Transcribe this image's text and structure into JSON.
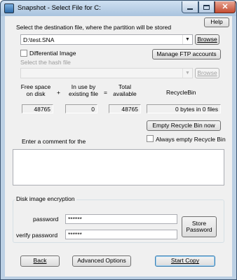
{
  "window": {
    "title": "Snapshot - Select File for C:",
    "help_label": "Help"
  },
  "destination": {
    "label": "Select the destination file, where the partition will be stored",
    "value": "D:\\test.SNA",
    "browse_label": "Browse"
  },
  "differential": {
    "checkbox_label": "Differential Image",
    "checked": false,
    "manage_ftp_label": "Manage FTP accounts",
    "hash_label": "Select the hash file",
    "hash_value": "",
    "hash_browse_label": "Browse"
  },
  "disk_stats": {
    "free_label_1": "Free space",
    "free_label_2": "on disk",
    "plus": "+",
    "inuse_label_1": "In use by",
    "inuse_label_2": "existing file",
    "equals": "=",
    "total_label_1": "Total",
    "total_label_2": "available",
    "recycle_label": "RecycleBin",
    "free_value": "48765",
    "inuse_value": "0",
    "total_value": "48765",
    "recycle_value": "0 bytes in 0 files"
  },
  "recycle": {
    "empty_button": "Empty Recycle Bin now",
    "always_label": "Always empty Recycle Bin",
    "always_checked": false
  },
  "comment": {
    "label": "Enter a comment for the",
    "value": ""
  },
  "encryption": {
    "group_label": "Disk image encryption",
    "password_label": "password",
    "password_value": "******",
    "verify_label": "verify password",
    "verify_value": "******",
    "store_label_1": "Store",
    "store_label_2": "Password"
  },
  "footer": {
    "back_label": "Back",
    "advanced_label": "Advanced Options",
    "start_label": "Start Copy"
  }
}
